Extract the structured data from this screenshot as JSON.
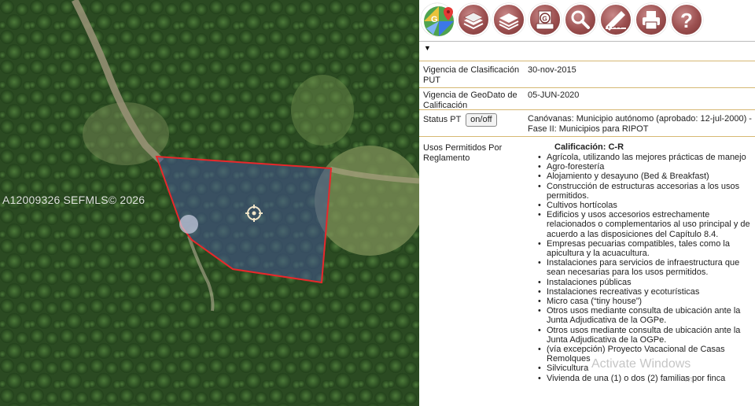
{
  "map": {
    "watermark": "A12009326  SEFMLS© 2026"
  },
  "toolbar": {
    "tools": [
      {
        "icon": "google-maps-icon"
      },
      {
        "icon": "layers-stack-icon"
      },
      {
        "icon": "layers-icon"
      },
      {
        "icon": "gis-document-icon"
      },
      {
        "icon": "magnifier-icon"
      },
      {
        "icon": "measure-pencil-icon"
      },
      {
        "icon": "printer-icon"
      },
      {
        "icon": "help-icon"
      }
    ],
    "colors": {
      "tool_bg": "#9b4f4f",
      "parcel_outline": "#e8282b"
    }
  },
  "info": {
    "vigencia_put_label": "Vigencia de Clasificación PUT",
    "vigencia_put_value": "30-nov-2015",
    "vigencia_geo_label": "Vigencia de GeoDato de Calificación",
    "vigencia_geo_value": "05-JUN-2020",
    "status_label": "Status PT",
    "status_button": "on/off",
    "status_value": "Canóvanas: Municipio autónomo (aprobado: 12-jul-2000) - Fase II: Municipios para RIPOT",
    "usos_label": "Usos Permitidos Por Reglamento",
    "calificacion": "Calificación: C-R",
    "usos": [
      "Agrícola, utilizando las mejores prácticas de manejo",
      "Agro-forestería",
      "Alojamiento y desayuno (Bed & Breakfast)",
      "Construcción de estructuras accesorias a los usos permitidos.",
      "Cultivos hortícolas",
      "Edificios y usos accesorios estrechamente relacionados o complementarios al uso principal y de acuerdo a las disposiciones del Capítulo 8.4.",
      "Empresas pecuarias compatibles, tales como la apicultura y la acuacultura.",
      "Instalaciones para servicios de infraestructura que sean necesarias para los usos permitidos.",
      "Instalaciones públicas",
      "Instalaciones recreativas y ecoturísticas",
      "Micro casa (“tiny house”)",
      "Otros usos mediante consulta de ubicación ante la Junta Adjudicativa de la OGPe.",
      "Otros usos mediante consulta de ubicación ante la Junta Adjudicativa de la OGPe.",
      "(vía excepción) Proyecto Vacacional de Casas Remolques",
      "Silvicultura",
      "Vivienda de una (1) o dos (2) familias por finca"
    ]
  },
  "overlay": {
    "activate": "Activate Windows",
    "activate_sub": "ws."
  }
}
